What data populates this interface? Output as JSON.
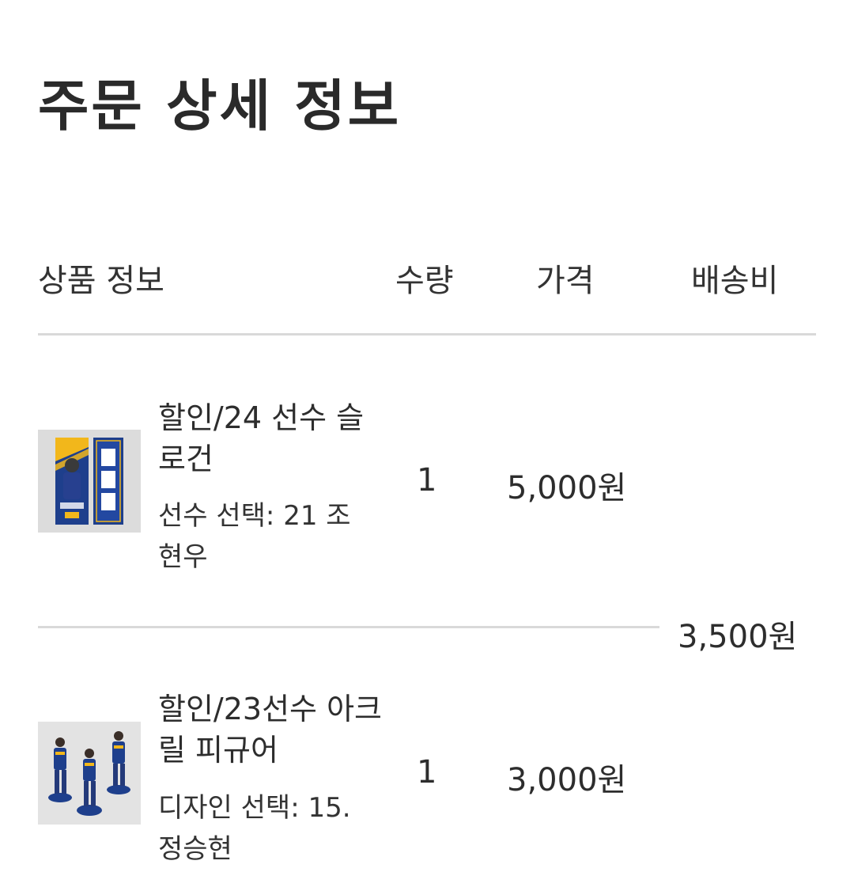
{
  "page": {
    "title": "주문 상세 정보"
  },
  "table": {
    "headers": {
      "product": "상품 정보",
      "quantity": "수량",
      "price": "가격",
      "shipping": "배송비"
    },
    "items": [
      {
        "name": "할인/24 선수 슬로건",
        "option": "선수 선택: 21 조현우",
        "quantity": "1",
        "price": "5,000원",
        "thumbnail_icon": "player-slogan-towel-image"
      },
      {
        "name": "할인/23선수 아크릴 피규어",
        "option": "디자인 선택: 15. 정승현",
        "quantity": "1",
        "price": "3,000원",
        "thumbnail_icon": "acrylic-figure-image"
      }
    ],
    "shipping_fee": "3,500원"
  },
  "colors": {
    "text": "#2b2b2b",
    "divider": "#d9d9d9",
    "thumb_bg": "#dcdcdc",
    "team_blue": "#1e3f8c",
    "team_gold": "#f2b71b"
  }
}
